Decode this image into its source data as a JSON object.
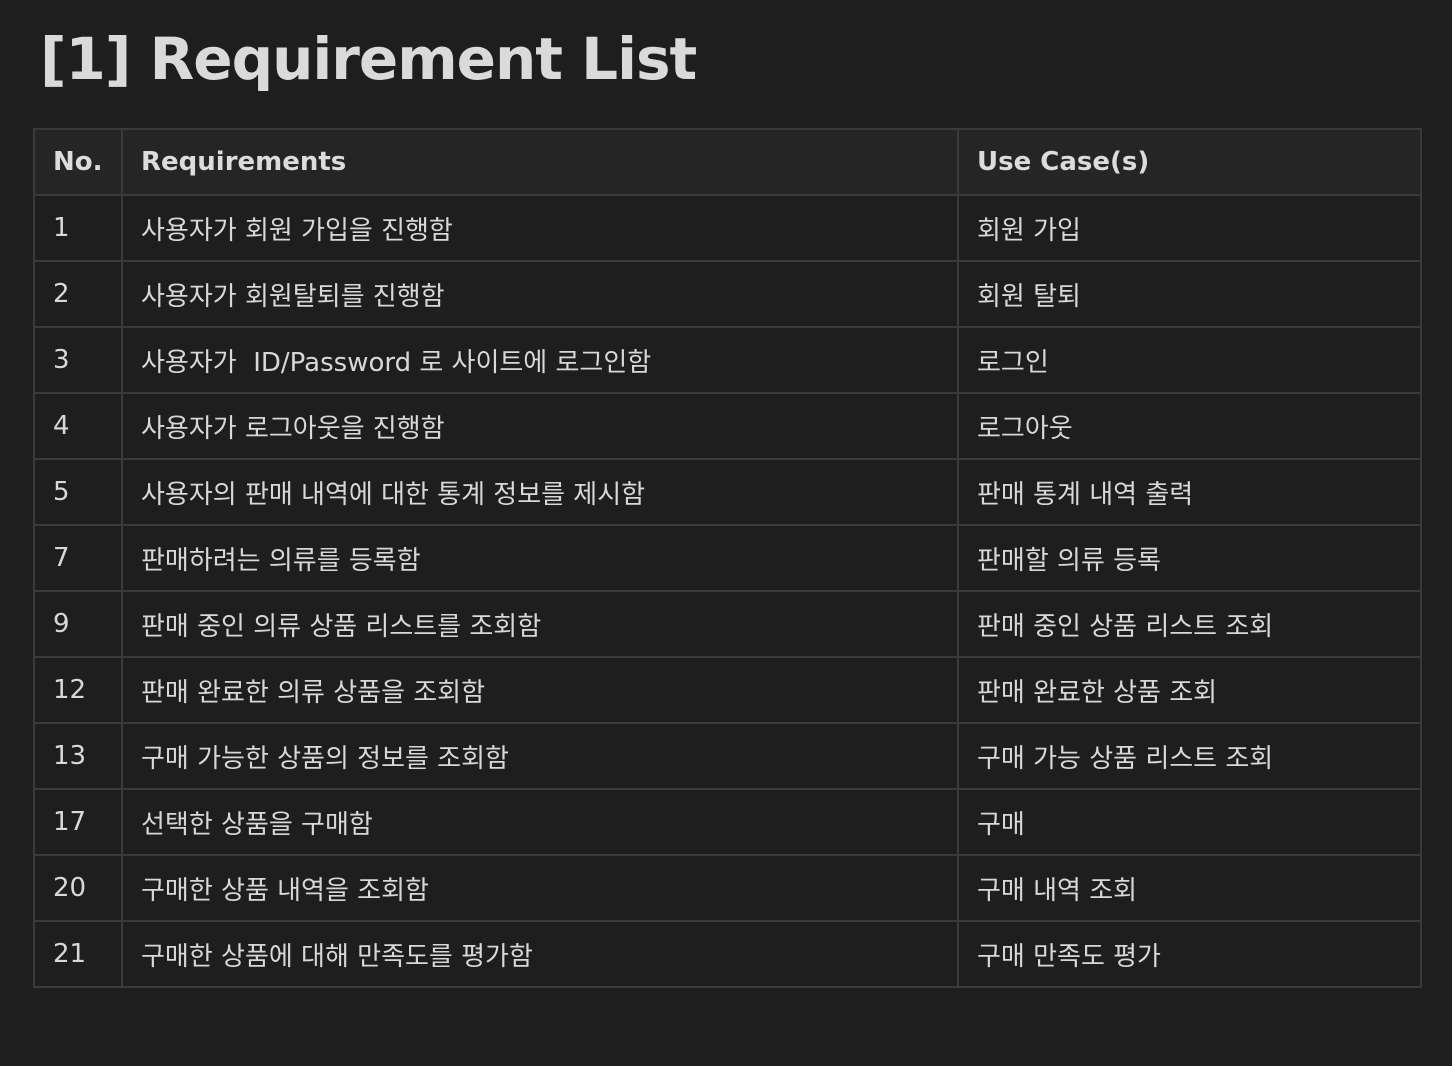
{
  "title": "[1] Requirement List",
  "table": {
    "headers": {
      "no": "No.",
      "requirements": "Requirements",
      "use_cases": "Use Case(s)"
    },
    "rows": [
      {
        "no": "1",
        "requirement": "사용자가 회원 가입을 진행함",
        "use_case": "회원 가입"
      },
      {
        "no": "2",
        "requirement": "사용자가 회원탈퇴를 진행함",
        "use_case": "회원 탈퇴"
      },
      {
        "no": "3",
        "requirement": "사용자가  ID/Password 로 사이트에 로그인함",
        "use_case": "로그인"
      },
      {
        "no": "4",
        "requirement": "사용자가 로그아웃을 진행함",
        "use_case": "로그아웃"
      },
      {
        "no": "5",
        "requirement": "사용자의 판매 내역에 대한 통계 정보를 제시함",
        "use_case": "판매 통계 내역 출력"
      },
      {
        "no": "7",
        "requirement": "판매하려는 의류를 등록함",
        "use_case": "판매할 의류 등록"
      },
      {
        "no": "9",
        "requirement": "판매 중인 의류 상품 리스트를 조회함",
        "use_case": "판매 중인 상품 리스트 조회"
      },
      {
        "no": "12",
        "requirement": "판매 완료한 의류 상품을 조회함",
        "use_case": "판매 완료한 상품 조회"
      },
      {
        "no": "13",
        "requirement": "구매 가능한 상품의 정보를 조회함",
        "use_case": "구매 가능 상품 리스트 조회"
      },
      {
        "no": "17",
        "requirement": "선택한 상품을 구매함",
        "use_case": "구매"
      },
      {
        "no": "20",
        "requirement": "구매한 상품 내역을 조회함",
        "use_case": "구매 내역 조회"
      },
      {
        "no": "21",
        "requirement": "구매한 상품에 대해 만족도를 평가함",
        "use_case": "구매 만족도 평가"
      }
    ]
  }
}
